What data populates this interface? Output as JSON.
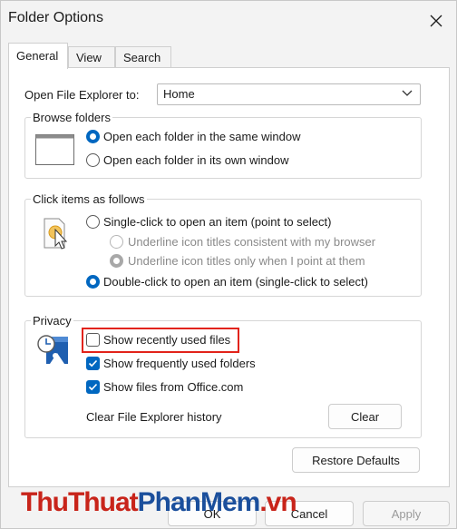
{
  "window": {
    "title": "Folder Options"
  },
  "tabs": [
    {
      "label": "General"
    },
    {
      "label": "View"
    },
    {
      "label": "Search"
    }
  ],
  "general": {
    "open_explorer_label": "Open File Explorer to:",
    "open_explorer_value": "Home",
    "browse": {
      "title": "Browse folders",
      "same_window": "Open each folder in the same window",
      "own_window": "Open each folder in its own window",
      "selected": "same_window"
    },
    "click": {
      "title": "Click items as follows",
      "single_click": "Single-click to open an item (point to select)",
      "underline_consistent": "Underline icon titles consistent with my browser",
      "underline_point": "Underline icon titles only when I point at them",
      "double_click": "Double-click to open an item (single-click to select)",
      "selected": "double_click"
    },
    "privacy": {
      "title": "Privacy",
      "recent_files": {
        "label": "Show recently used files",
        "checked": false
      },
      "frequent_folders": {
        "label": "Show frequently used folders",
        "checked": true
      },
      "office_files": {
        "label": "Show files from Office.com",
        "checked": true
      },
      "clear_history_label": "Clear File Explorer history",
      "clear_button": "Clear"
    },
    "restore_defaults": "Restore Defaults"
  },
  "footer": {
    "ok": "OK",
    "cancel": "Cancel",
    "apply": "Apply"
  },
  "watermark": {
    "part1": "ThuThuat",
    "part2": "PhanMem",
    "part3": ".vn"
  },
  "colors": {
    "accent": "#0067c0",
    "highlight": "#e2231a",
    "watermark_red": "#c8241a",
    "watermark_blue": "#1b4f9c"
  },
  "icons": [
    "close-icon",
    "chevron-down-icon",
    "folder-window-icon",
    "pointer-click-icon",
    "privacy-clock-icon",
    "checkmark-icon"
  ]
}
